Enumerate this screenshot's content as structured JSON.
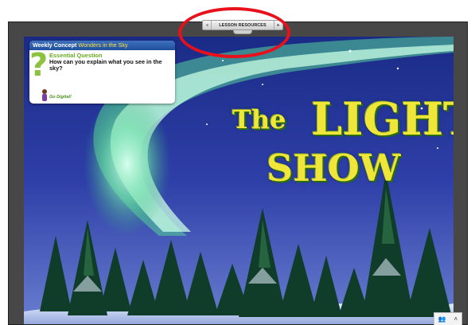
{
  "lesson_bar": {
    "prev_arrow": "◂",
    "label": "LESSON RESOURCES",
    "next_arrow": "▸"
  },
  "card": {
    "header_label": "Weekly Concept",
    "concept": "Wonders in the Sky",
    "question_mark": "?",
    "eq_heading": "Essential Question",
    "question": "How can you explain what you see in the sky?",
    "go_digital": "Go Digital!"
  },
  "title": {
    "the": "The",
    "light": "LIGHT",
    "show": "SHOW"
  },
  "corner": {
    "people_icon": "👥",
    "chevron": "˄"
  },
  "colors": {
    "accent_red_circle": "#e8101a",
    "title_yellow": "#f0e63a",
    "card_header_blue": "#2b5fae",
    "eq_green": "#6aaa24"
  }
}
